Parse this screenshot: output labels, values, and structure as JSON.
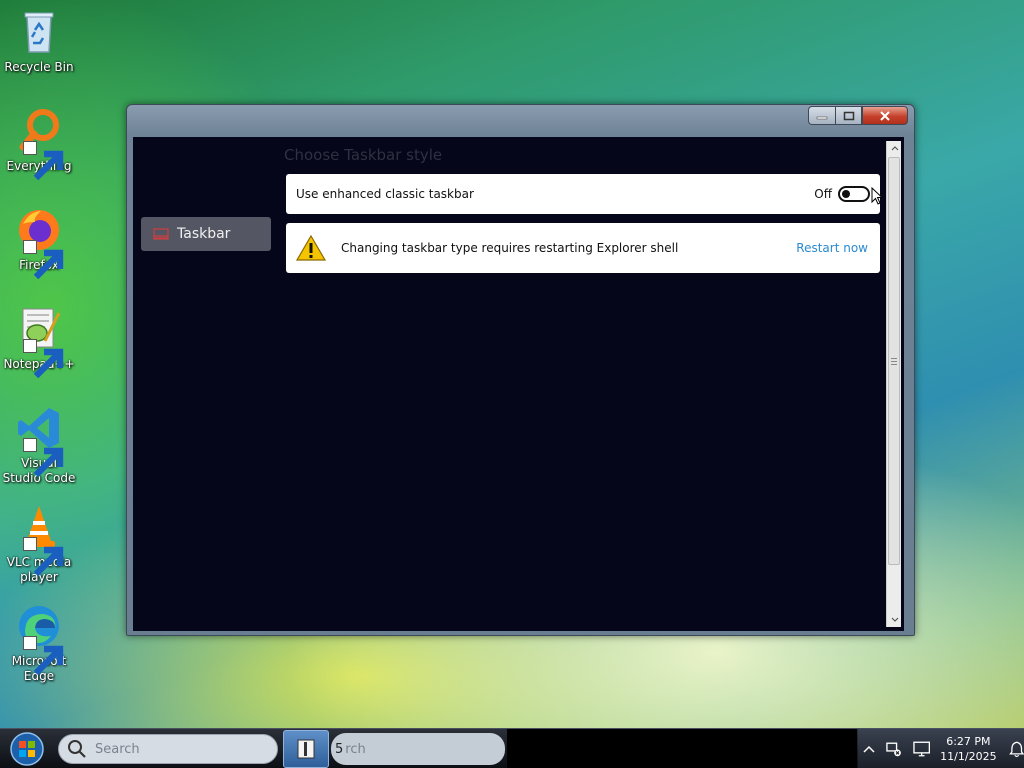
{
  "desktop": {
    "icons": [
      {
        "label": "Recycle Bin",
        "icon": "recycle-bin-icon"
      },
      {
        "label": "Everything",
        "icon": "everything-search-icon"
      },
      {
        "label": "Firefox",
        "icon": "firefox-icon"
      },
      {
        "label": "Notepad++",
        "icon": "notepad-plus-plus-icon"
      },
      {
        "label": "Visual Studio Code",
        "icon": "vscode-icon"
      },
      {
        "label": "VLC media player",
        "icon": "vlc-icon"
      },
      {
        "label": "Microsoft Edge",
        "icon": "edge-icon"
      }
    ]
  },
  "window": {
    "nav": {
      "label": "Taskbar",
      "icon": "taskbar-icon"
    },
    "section_title": "Choose Taskbar style",
    "toggle_setting": {
      "label": "Use enhanced classic taskbar",
      "state": "Off"
    },
    "warning": {
      "message": "Changing taskbar type requires restarting Explorer shell",
      "action": "Restart now",
      "icon": "warning-icon"
    }
  },
  "taskbar": {
    "search_placeholder": "Search",
    "search_preview_text": "rch",
    "preview_badge": "5",
    "clock": {
      "time": "6:27 PM",
      "date": "11/1/2025"
    }
  },
  "colors": {
    "window_bg": "#06061a",
    "accent_link": "#2a8ad0",
    "nav_selected": "#545663",
    "warning": "#f5c400"
  }
}
